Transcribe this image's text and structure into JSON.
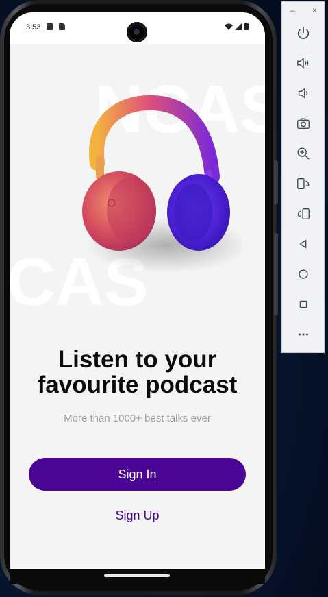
{
  "status_bar": {
    "time": "3:53"
  },
  "background_words": {
    "top": "NCAS",
    "middle": "CAS"
  },
  "onboarding": {
    "title_line1": "Listen to your",
    "title_line2": "favourite podcast",
    "subtitle": "More than 1000+ best talks ever",
    "sign_in_label": "Sign In",
    "sign_up_label": "Sign Up"
  },
  "colors": {
    "primary": "#4a0595",
    "screen_bg": "#f4f4f5",
    "subtitle": "#9b9ea6"
  },
  "emulator_toolbar": {
    "minimize": "–",
    "close": "×",
    "buttons": [
      "power-icon",
      "volume-up-icon",
      "volume-down-icon",
      "camera-icon",
      "zoom-icon",
      "rotate-left-icon",
      "rotate-right-icon",
      "back-icon",
      "home-icon",
      "overview-icon",
      "more-icon"
    ]
  }
}
